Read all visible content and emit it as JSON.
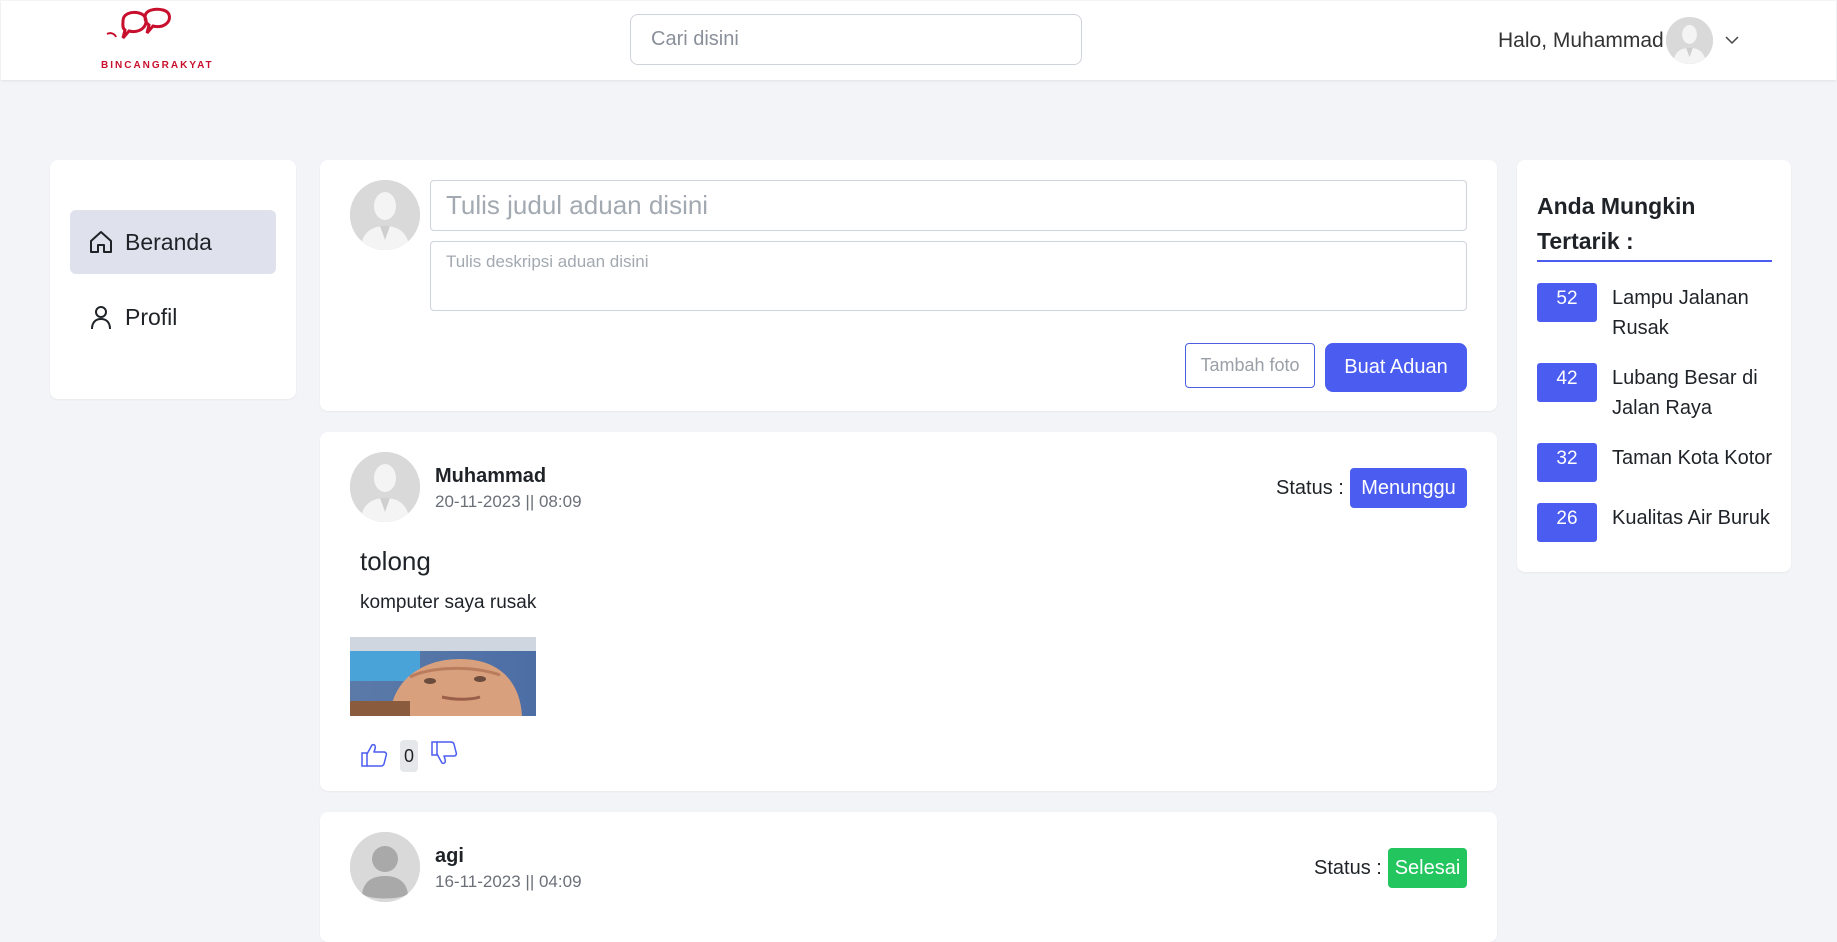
{
  "header": {
    "logo_text": "BINCANGRAKYAT",
    "search_placeholder": "Cari disini",
    "greeting": "Halo, Muhammad"
  },
  "sidebar": {
    "items": [
      {
        "label": "Beranda",
        "icon": "home-icon",
        "active": true
      },
      {
        "label": "Profil",
        "icon": "user-icon",
        "active": false
      }
    ]
  },
  "composer": {
    "title_placeholder": "Tulis judul aduan disini",
    "description_placeholder": "Tulis deskripsi aduan disini",
    "add_photo_label": "Tambah foto",
    "submit_label": "Buat Aduan"
  },
  "posts": [
    {
      "author": "Muhammad",
      "date": "20-11-2023 || 08:09",
      "status_label": "Status :",
      "status": "Menunggu",
      "status_color": "#4b5cf0",
      "title": "tolong",
      "description": "komputer saya rusak",
      "votes": "0"
    },
    {
      "author": "agi",
      "date": "16-11-2023 || 04:09",
      "status_label": "Status :",
      "status": "Selesai",
      "status_color": "#22c55e"
    }
  ],
  "recommendations": {
    "title": "Anda Mungkin Tertarik :",
    "items": [
      {
        "count": "52",
        "label": "Lampu Jalanan Rusak"
      },
      {
        "count": "42",
        "label": "Lubang Besar di Jalan Raya"
      },
      {
        "count": "32",
        "label": "Taman Kota Kotor"
      },
      {
        "count": "26",
        "label": "Kualitas Air Buruk"
      }
    ]
  },
  "colors": {
    "accent": "#4b5cf0",
    "success": "#22c55e",
    "logo": "#c8102e",
    "background": "#f3f4f7"
  }
}
